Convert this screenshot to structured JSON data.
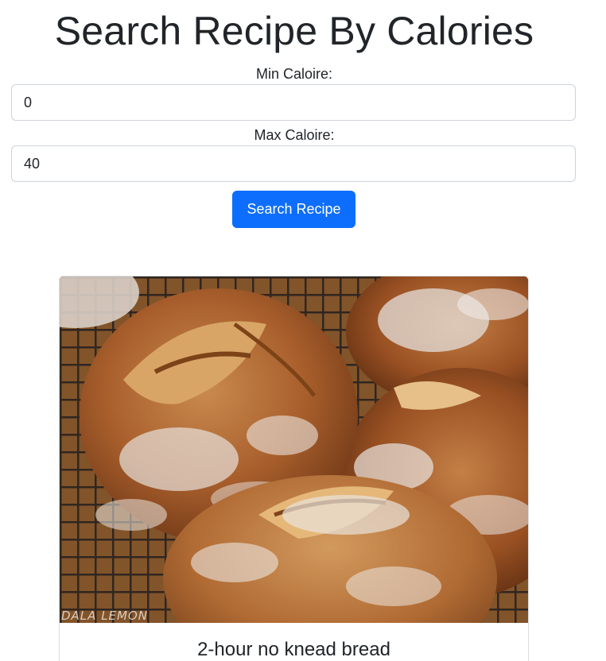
{
  "page": {
    "title": "Search Recipe By Calories"
  },
  "form": {
    "min_label": "Min Caloire:",
    "min_value": "0",
    "max_label": "Max Caloire:",
    "max_value": "40",
    "submit_label": "Search Recipe"
  },
  "results": [
    {
      "title": "2-hour no knead bread",
      "image_watermark": "DALA LEMON"
    }
  ],
  "colors": {
    "primary": "#0d6efd",
    "text": "#212529",
    "border": "#ced4da"
  }
}
